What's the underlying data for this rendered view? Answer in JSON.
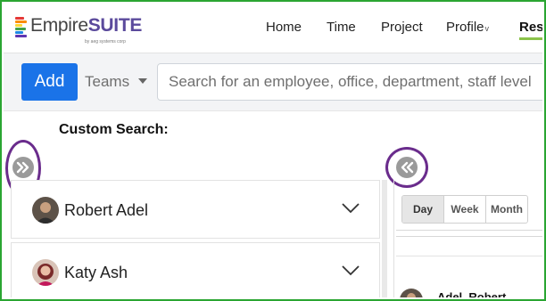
{
  "app": {
    "logo_text_a": "Empire",
    "logo_text_b": "SUITE",
    "logo_subtitle": "by aeg systems corp"
  },
  "nav": {
    "items": [
      {
        "label": "Home"
      },
      {
        "label": "Time"
      },
      {
        "label": "Project"
      },
      {
        "label": "Profile"
      },
      {
        "label": "Reso"
      }
    ],
    "profile_caret": "v",
    "active_index": 4
  },
  "toolbar": {
    "add_label": "Add",
    "teams_label": "Teams",
    "search_placeholder": "Search for an employee, office, department, staff level"
  },
  "custom_search": {
    "label": "Custom Search:"
  },
  "people": [
    {
      "name": "Robert Adel"
    },
    {
      "name": "Katy Ash"
    }
  ],
  "view_modes": {
    "options": [
      "Day",
      "Week",
      "Month"
    ],
    "selected": "Day"
  },
  "schedule": {
    "first_employee": "Adel, Robert"
  },
  "colors": {
    "frame_border": "#2aa532",
    "add_button": "#1a73e8",
    "highlight_ring": "#6a2c8c",
    "logo_accent": "#5b4a9c",
    "nav_active_underline": "#8bc34a"
  }
}
